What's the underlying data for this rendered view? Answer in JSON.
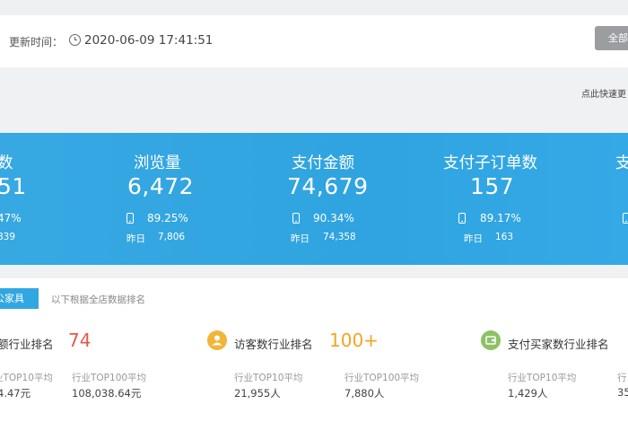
{
  "update_bar": {
    "label": "更新时间：",
    "time": "2020-06-09 17:41:51",
    "button_label": "全部"
  },
  "quick_hint": "点此快速更",
  "metrics": [
    {
      "title": "数",
      "value": "51",
      "pct": "47%",
      "yesterday_value": "839"
    },
    {
      "title": "浏览量",
      "value": "6,472",
      "pct": "89.25%",
      "yesterday_label": "昨日",
      "yesterday_value": "7,806"
    },
    {
      "title": "支付金额",
      "value": "74,679",
      "pct": "90.34%",
      "yesterday_label": "昨日",
      "yesterday_value": "74,358"
    },
    {
      "title": "支付子订单数",
      "value": "157",
      "pct": "89.17%",
      "yesterday_label": "昨日",
      "yesterday_value": "163"
    },
    {
      "title": "支"
    }
  ],
  "rank_panel": {
    "tab_label": "公家具",
    "tab_note": "以下根据全店数据排名",
    "items": [
      {
        "label": "额行业排名",
        "value": "74",
        "value_color": "#e4594b",
        "top10_label": "业TOP10平均",
        "top10_value": "4.47元",
        "top100_label": "行业TOP100平均",
        "top100_value": "108,038.64元"
      },
      {
        "label": "访客数行业排名",
        "value": "100+",
        "value_color": "#f2a623",
        "icon": "person-icon",
        "icon_color": "#f2b53a",
        "top10_label": "行业TOP10平均",
        "top10_value": "21,955人",
        "top100_label": "行业TOP100平均",
        "top100_value": "7,880人"
      },
      {
        "label": "支付买家数行业排名",
        "icon": "wallet-icon",
        "icon_color": "#8cc265",
        "top10_label": "行业TOP10平均",
        "top10_value": "1,429人",
        "top100_label": "行",
        "top100_value": "35"
      }
    ]
  }
}
